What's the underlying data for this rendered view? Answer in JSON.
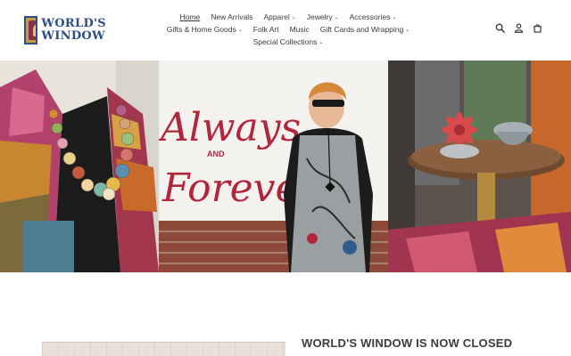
{
  "logo": {
    "line1": "WORLD'S",
    "line2": "WINDOW"
  },
  "nav": {
    "row1": [
      {
        "label": "Home",
        "dropdown": false,
        "active": true
      },
      {
        "label": "New Arrivals",
        "dropdown": false
      },
      {
        "label": "Apparel",
        "dropdown": true
      },
      {
        "label": "Jewelry",
        "dropdown": true
      },
      {
        "label": "Accessories",
        "dropdown": true
      }
    ],
    "row2": [
      {
        "label": "Gifts & Home Goods",
        "dropdown": true
      },
      {
        "label": "Folk Art",
        "dropdown": false
      },
      {
        "label": "Music",
        "dropdown": false
      },
      {
        "label": "Gift Cards and Wrapping",
        "dropdown": true
      }
    ],
    "row3": [
      {
        "label": "Special Collections",
        "dropdown": true
      }
    ]
  },
  "header_icons": [
    "search-icon",
    "account-icon",
    "cart-icon"
  ],
  "hero": {
    "panel1_text": "",
    "mural_text_line1": "Always",
    "mural_text_line2": "AND",
    "mural_text_line3": "Forever"
  },
  "main": {
    "heading": "WORLD'S WINDOW IS NOW CLOSED"
  },
  "colors": {
    "brand_blue": "#2c4f83",
    "mural_red": "#b0263b",
    "text": "#333333"
  }
}
